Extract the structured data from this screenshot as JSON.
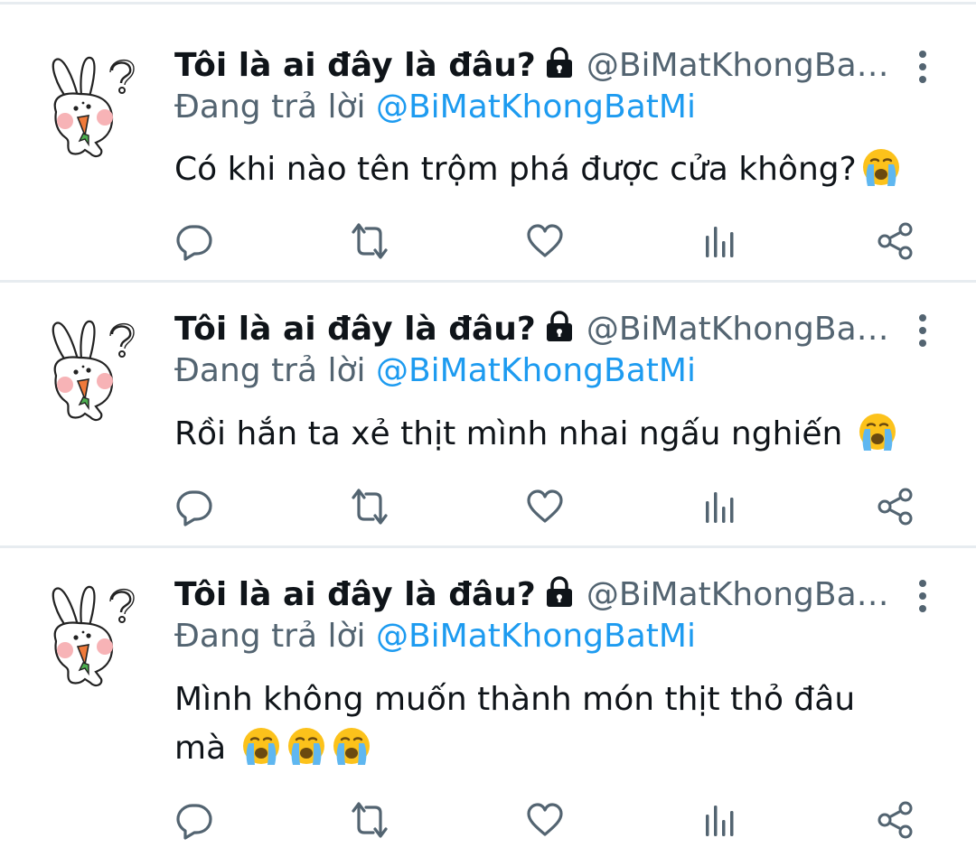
{
  "tweets": [
    {
      "display_name": "Tôi là ai đây là đâu?",
      "handle": "@BiMatKhongBa…",
      "reply_prefix": "Đang trả lời ",
      "reply_to": "@BiMatKhongBatMi",
      "text": "Có khi nào tên trộm phá được cửa không?",
      "emojis": [
        "loudly-crying-face"
      ]
    },
    {
      "display_name": "Tôi là ai đây là đâu?",
      "handle": "@BiMatKhongBa…",
      "reply_prefix": "Đang trả lời ",
      "reply_to": "@BiMatKhongBatMi",
      "text": "Rồi hắn ta xẻ thịt mình nhai ngấu nghiến ",
      "emojis": [
        "loudly-crying-face"
      ]
    },
    {
      "display_name": "Tôi là ai đây là đâu?",
      "handle": "@BiMatKhongBa…",
      "reply_prefix": "Đang trả lời ",
      "reply_to": "@BiMatKhongBatMi",
      "text_line1": "Mình không muốn thành món thịt thỏ đâu",
      "text_line2": "mà ",
      "emojis": [
        "loudly-crying-face",
        "loudly-crying-face",
        "loudly-crying-face"
      ]
    }
  ],
  "icons": {
    "avatar": "bunny-with-carrot-avatar",
    "lock": "lock-icon",
    "more": "more-vertical-icon",
    "reply": "reply-icon",
    "retweet": "retweet-icon",
    "like": "heart-icon",
    "analytics": "analytics-icon",
    "share": "share-icon"
  },
  "colors": {
    "link": "#1d9bf0",
    "secondary_text": "#536471",
    "primary_text": "#0f1419",
    "divider": "#e7ecf0",
    "icon": "#536471"
  }
}
